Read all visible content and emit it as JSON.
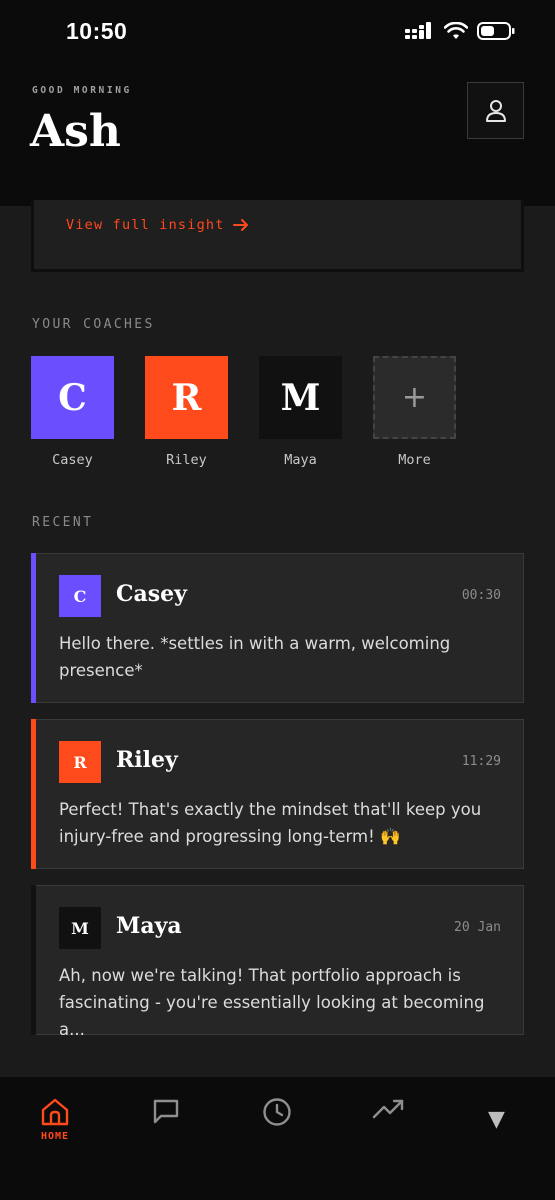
{
  "status_bar": {
    "time": "10:50"
  },
  "header": {
    "greeting": "GOOD MORNING",
    "user_name": "Ash"
  },
  "insight": {
    "link_label": "View full insight"
  },
  "coaches": {
    "section_label": "YOUR COACHES",
    "items": [
      {
        "initial": "C",
        "name": "Casey",
        "color": "#6b4fff"
      },
      {
        "initial": "R",
        "name": "Riley",
        "color": "#ff4a1c"
      },
      {
        "initial": "M",
        "name": "Maya",
        "color": "#111111"
      }
    ],
    "more": {
      "symbol": "+",
      "label": "More"
    }
  },
  "recent": {
    "section_label": "RECENT",
    "chats": [
      {
        "initial": "C",
        "name": "Casey",
        "time": "00:30",
        "message": "Hello there. *settles in with a warm, welcoming presence*",
        "color": "#6b4fff"
      },
      {
        "initial": "R",
        "name": "Riley",
        "time": "11:29",
        "message": "Perfect! That's exactly the mindset that'll keep you injury-free and progressing long-term! 🙌",
        "color": "#ff4a1c"
      },
      {
        "initial": "M",
        "name": "Maya",
        "time": "20 Jan",
        "message": "Ah, now we're talking! That portfolio approach is fascinating - you're essentially looking at becoming a...",
        "color": "#111111"
      }
    ]
  },
  "nav": {
    "items": [
      {
        "icon": "home-icon",
        "label": "HOME",
        "active": true
      },
      {
        "icon": "chat-icon"
      },
      {
        "icon": "history-icon"
      },
      {
        "icon": "progress-icon"
      },
      {
        "icon": "more-icon"
      }
    ]
  },
  "colors": {
    "accent": "#ff4a1c",
    "background": "#1b1b1b"
  }
}
